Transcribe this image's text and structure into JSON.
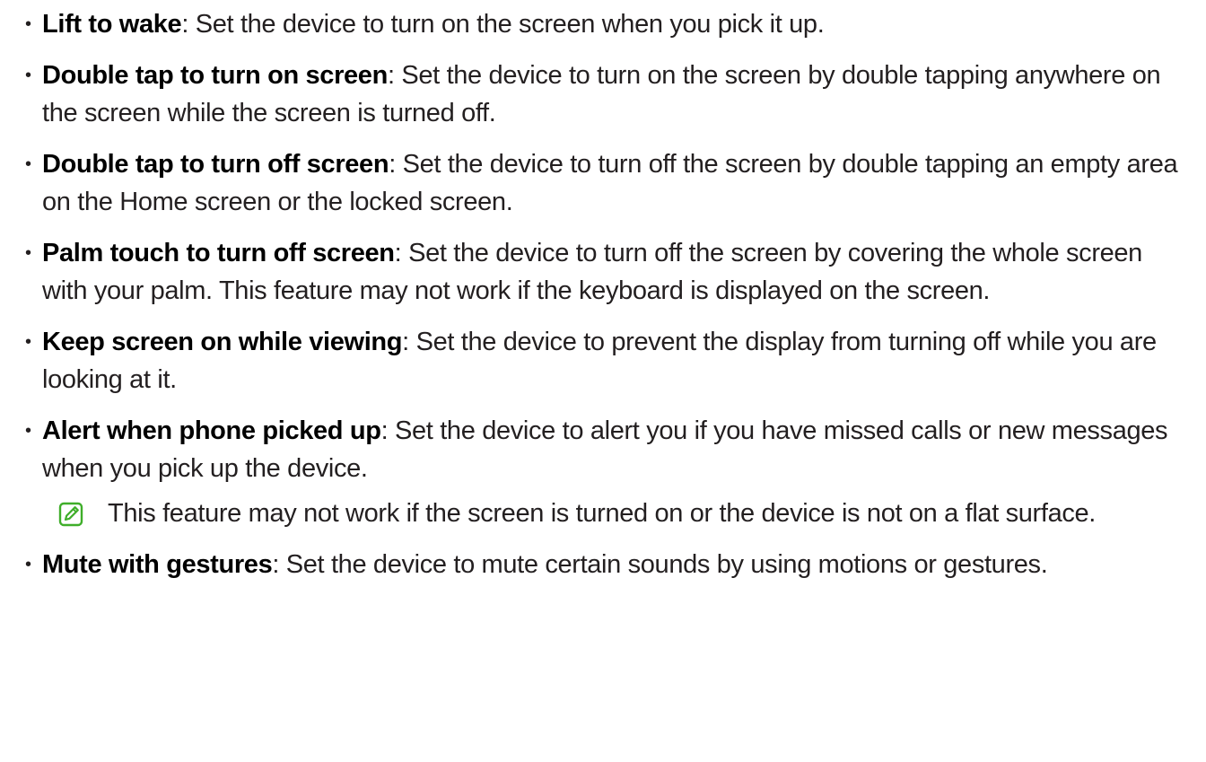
{
  "items": [
    {
      "term": "Lift to wake",
      "separator": ":",
      "desc": " Set the device to turn on the screen when you pick it up."
    },
    {
      "term": "Double tap to turn on screen",
      "separator": ":",
      "desc": " Set the device to turn on the screen by double tapping anywhere on the screen while the screen is turned off."
    },
    {
      "term": "Double tap to turn off screen",
      "separator": ":",
      "desc": " Set the device to turn off the screen by double tapping an empty area on the Home screen or the locked screen."
    },
    {
      "term": "Palm touch to turn off screen",
      "separator": ":",
      "desc": " Set the device to turn off the screen by covering the whole screen with your palm. This feature may not work if the keyboard is displayed on the screen."
    },
    {
      "term": "Keep screen on while viewing",
      "separator": ":",
      "desc": " Set the device to prevent the display from turning off while you are looking at it."
    },
    {
      "term": "Alert when phone picked up",
      "separator": ":",
      "desc": " Set the device to alert you if you have missed calls or new messages when you pick up the device."
    },
    {
      "term": "Mute with gestures",
      "separator": ":",
      "desc": " Set the device to mute certain sounds by using motions or gestures."
    }
  ],
  "bullet_char": "•",
  "note": {
    "icon": "note-pencil-icon",
    "text": "This feature may not work if the screen is turned on or the device is not on a flat surface."
  },
  "colors": {
    "text": "#231f20",
    "note_icon": "#3fae2a"
  }
}
